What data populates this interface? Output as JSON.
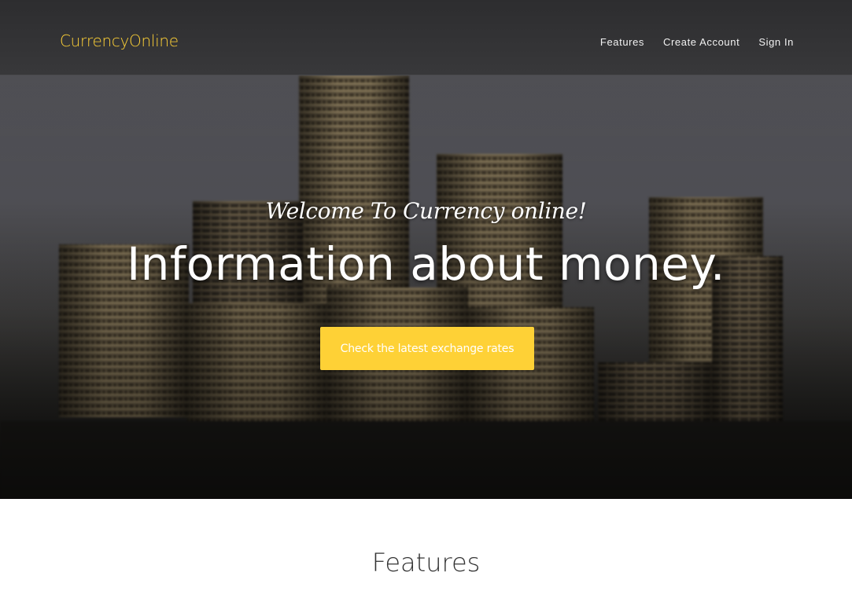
{
  "navbar": {
    "brand": "CurrencyOnline",
    "brand_color": "#fed136",
    "links": [
      {
        "label": "Features"
      },
      {
        "label": "Create Account"
      },
      {
        "label": "Sign In"
      }
    ]
  },
  "hero": {
    "welcome": "Welcome To Currency online!",
    "heading": "Information about money.",
    "cta_label": "Check the latest exchange rates",
    "cta_color": "#fed136",
    "background_image": "coin-stacks"
  },
  "features": {
    "heading": "Features"
  }
}
